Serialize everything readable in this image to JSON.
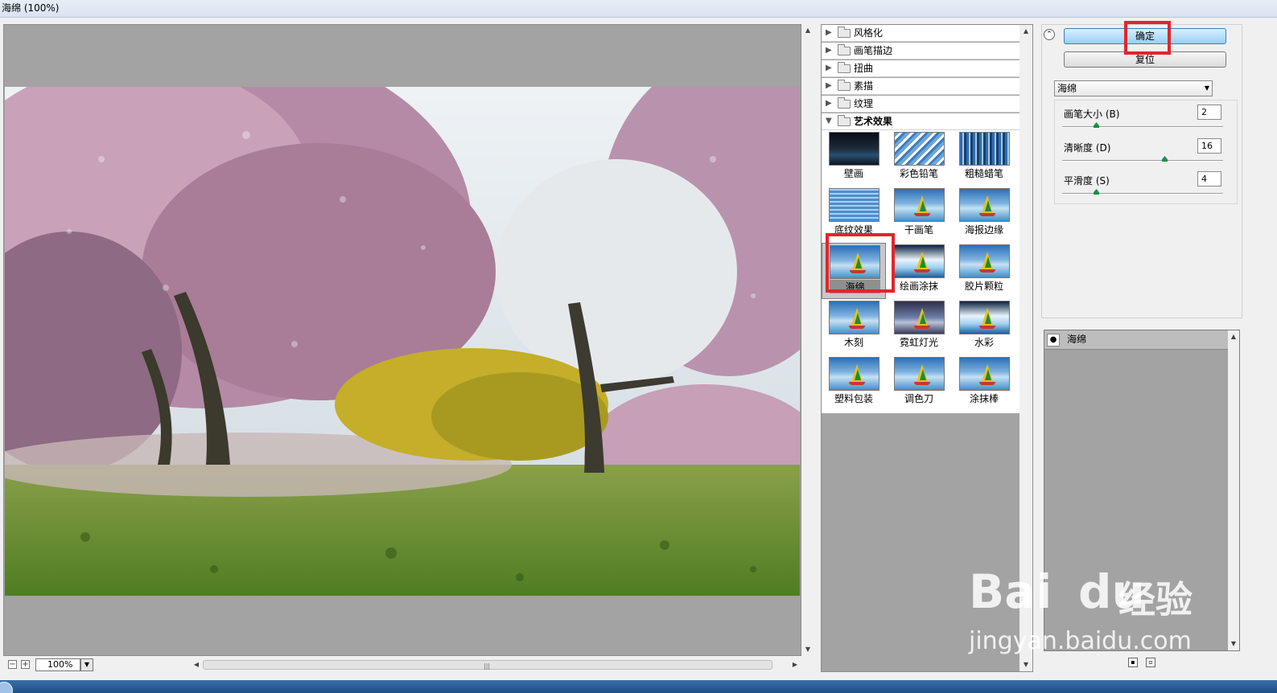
{
  "window": {
    "title": "海绵 (100%)"
  },
  "preview": {
    "zoom": "100%",
    "zoom_out": "−",
    "zoom_in": "+",
    "grip": "|||"
  },
  "categories": [
    {
      "label": "风格化",
      "state": "collapsed"
    },
    {
      "label": "画笔描边",
      "state": "collapsed"
    },
    {
      "label": "扭曲",
      "state": "collapsed"
    },
    {
      "label": "素描",
      "state": "collapsed"
    },
    {
      "label": "纹理",
      "state": "collapsed"
    },
    {
      "label": "艺术效果",
      "state": "expanded"
    }
  ],
  "filters": [
    {
      "label": "壁画"
    },
    {
      "label": "彩色铅笔"
    },
    {
      "label": "粗糙蜡笔"
    },
    {
      "label": "底纹效果"
    },
    {
      "label": "干画笔"
    },
    {
      "label": "海报边缘"
    },
    {
      "label": "海绵",
      "selected": true
    },
    {
      "label": "绘画涂抹"
    },
    {
      "label": "胶片颗粒"
    },
    {
      "label": "木刻"
    },
    {
      "label": "霓虹灯光"
    },
    {
      "label": "水彩"
    },
    {
      "label": "塑料包装"
    },
    {
      "label": "调色刀"
    },
    {
      "label": "涂抹棒"
    }
  ],
  "buttons": {
    "ok": "确定",
    "reset": "复位"
  },
  "filter_select": {
    "value": "海绵"
  },
  "params": {
    "brush_size": {
      "label": "画笔大小 (B)",
      "value": "2",
      "fraction": 0.2
    },
    "definition": {
      "label": "清晰度 (D)",
      "value": "16",
      "fraction": 0.64
    },
    "smoothness": {
      "label": "平滑度 (S)",
      "value": "4",
      "fraction": 0.2
    }
  },
  "effect_layers": [
    {
      "name": "海绵"
    }
  ],
  "watermark": {
    "brand": "Bai",
    "brand2": "du",
    "cn": "经验",
    "url": "jingyan.baidu.com"
  },
  "colors": {
    "accent_highlight": "#e0262c",
    "panel_gray": "#a3a3a3"
  }
}
